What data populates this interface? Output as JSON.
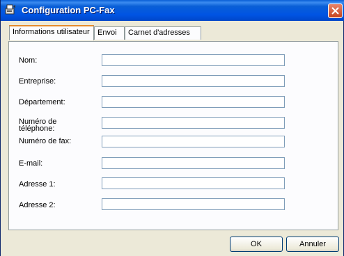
{
  "window": {
    "title": "Configuration PC-Fax",
    "title_icon": "fax-app-icon",
    "close_icon": "close-icon"
  },
  "tabs": [
    {
      "label": "Informations utilisateur",
      "active": true
    },
    {
      "label": "Envoi",
      "active": false
    },
    {
      "label": "Carnet d'adresses",
      "active": false
    }
  ],
  "form": {
    "fields": [
      {
        "label": "Nom:",
        "value": ""
      },
      {
        "label": "Entreprise:",
        "value": ""
      },
      {
        "label": "Département:",
        "value": ""
      },
      {
        "label": "Numéro de",
        "label2": "téléphone:",
        "value": ""
      },
      {
        "label": "Numéro de fax:",
        "value": ""
      },
      {
        "label": "E-mail:",
        "value": ""
      },
      {
        "label": "Adresse 1:",
        "value": ""
      },
      {
        "label": "Adresse 2:",
        "value": ""
      }
    ]
  },
  "buttons": {
    "ok": "OK",
    "cancel": "Annuler"
  },
  "colors": {
    "titlebar": "#0054e3",
    "active_tab_accent": "#e68b2c",
    "close_button": "#c6441f"
  }
}
